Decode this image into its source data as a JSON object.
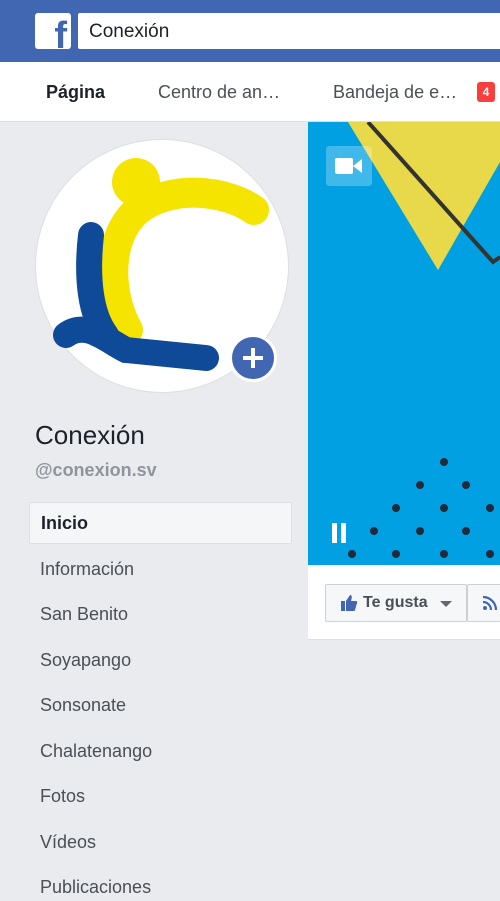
{
  "header": {
    "logo_icon": "facebook-logo-icon",
    "search_value": "Conexión"
  },
  "tabs": [
    {
      "label": "Página",
      "active": true
    },
    {
      "label": "Centro de an…",
      "active": false
    },
    {
      "label": "Bandeja de e…",
      "active": false,
      "badge": "4"
    }
  ],
  "profile": {
    "name": "Conexión",
    "handle": "@conexion.sv",
    "add_photo_icon": "plus-icon"
  },
  "nav": [
    {
      "label": "Inicio",
      "active": true
    },
    {
      "label": "Información"
    },
    {
      "label": "San Benito"
    },
    {
      "label": "Soyapango"
    },
    {
      "label": "Sonsonate"
    },
    {
      "label": "Chalatenango"
    },
    {
      "label": "Fotos"
    },
    {
      "label": "Vídeos"
    },
    {
      "label": "Publicaciones"
    }
  ],
  "cover": {
    "video_icon": "video-camera-icon",
    "pause_icon": "pause-icon"
  },
  "actions": {
    "like_label": "Te gusta",
    "like_icon": "thumbs-up-icon",
    "follow_icon": "rss-icon"
  },
  "colors": {
    "brand_blue": "#4267b2",
    "cover_blue": "#00a0e3",
    "cover_yellow": "#e8d94a",
    "logo_yellow": "#f5e400",
    "logo_navy": "#0f4a98",
    "badge_red": "#fa3e3e"
  }
}
